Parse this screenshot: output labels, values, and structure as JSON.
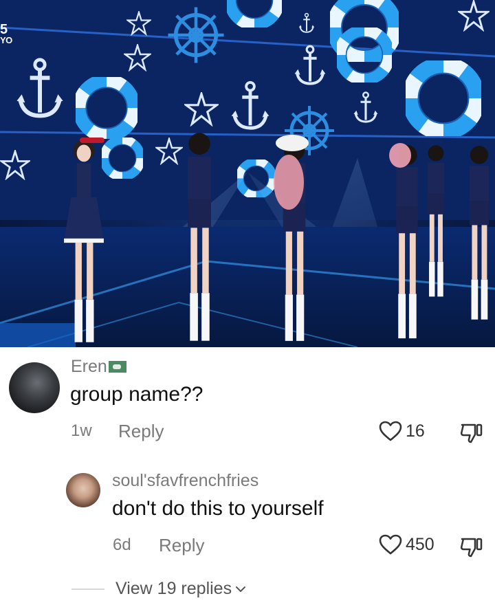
{
  "video": {
    "channel_logo_mark": "5",
    "channel_logo_text": "YO"
  },
  "comments": [
    {
      "username": "Eren",
      "flag_icon": "flag-icon",
      "text": "group name??",
      "time": "1w",
      "reply_label": "Reply",
      "likes": "16"
    },
    {
      "username": "soul'sfavfrenchfries",
      "text": "don't do this to yourself",
      "time": "6d",
      "reply_label": "Reply",
      "likes": "450"
    }
  ],
  "view_replies_label": "View 19 replies",
  "colors": {
    "video_bg": "#0c2358",
    "lifebuoy_blue": "#2aa0f0",
    "meta_gray": "#7a7a7a",
    "text": "#111111"
  }
}
